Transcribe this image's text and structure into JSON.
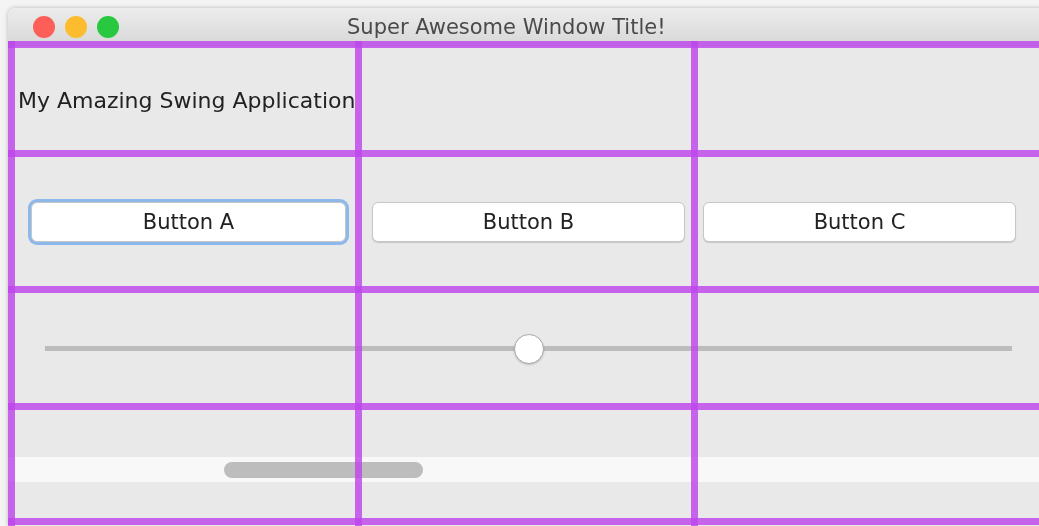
{
  "window": {
    "title": "Super Awesome Window Title!"
  },
  "label": "My Amazing Swing Application",
  "buttons": [
    {
      "label": "Button A",
      "focused": true
    },
    {
      "label": "Button B",
      "focused": false
    },
    {
      "label": "Button C",
      "focused": false
    }
  ],
  "slider": {
    "level": 0.5
  }
}
